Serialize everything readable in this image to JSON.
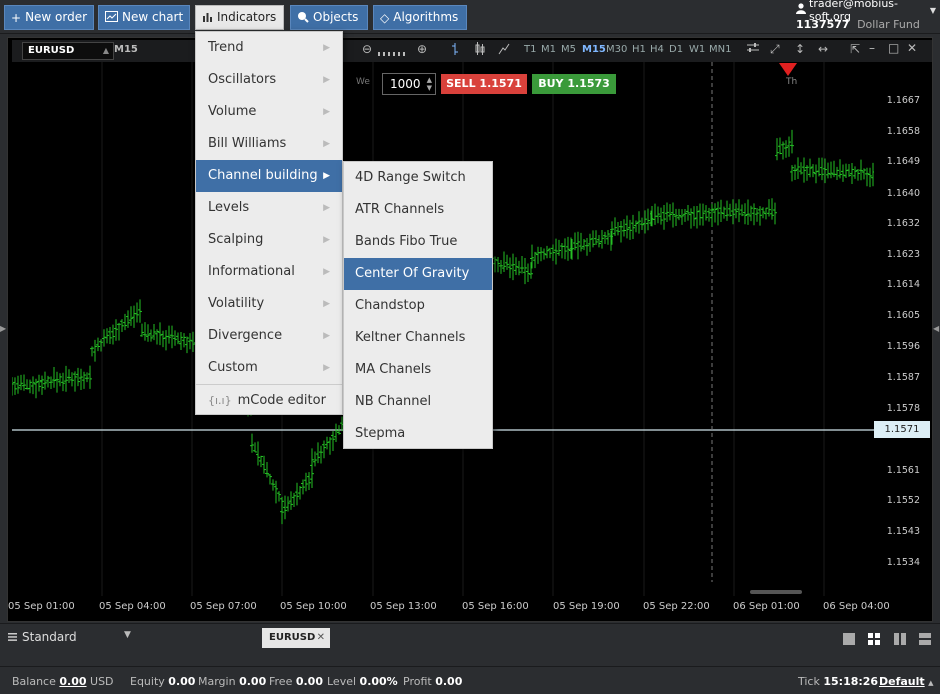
{
  "toolbar": {
    "new_order": "New order",
    "new_chart": "New chart",
    "indicators": "Indicators",
    "objects": "Objects",
    "algorithms": "Algorithms"
  },
  "account": {
    "user": "trader@mobius-soft.org",
    "number": "1137577",
    "fund": "Dollar Fund"
  },
  "chart": {
    "symbol": "EURUSD",
    "timeframe": "M15",
    "timeframes": [
      "T1",
      "M1",
      "M5",
      "M15",
      "M30",
      "H1",
      "H4",
      "D1",
      "W1",
      "MN1"
    ],
    "selected_timeframe": "M15",
    "we_label": "We",
    "th_label": "Th",
    "quantity": "1000",
    "sell_label": "SELL 1.1571",
    "buy_label": "BUY 1.1573",
    "current_price": "1.1571",
    "price_ticks": [
      "1.1667",
      "1.1658",
      "1.1649",
      "1.1640",
      "1.1632",
      "1.1623",
      "1.1614",
      "1.1605",
      "1.1596",
      "1.1587",
      "1.1578",
      "1.1561",
      "1.1552",
      "1.1543",
      "1.1534"
    ],
    "time_ticks": [
      "05 Sep 01:00",
      "05 Sep 04:00",
      "05 Sep 07:00",
      "05 Sep 10:00",
      "05 Sep 13:00",
      "05 Sep 16:00",
      "05 Sep 19:00",
      "05 Sep 22:00",
      "06 Sep 01:00",
      "06 Sep 04:00"
    ],
    "candle_color": "#25c025"
  },
  "indicators_menu": {
    "items": [
      "Trend",
      "Oscillators",
      "Volume",
      "Bill Williams",
      "Channel building",
      "Levels",
      "Scalping",
      "Informational",
      "Volatility",
      "Divergence",
      "Custom"
    ],
    "selected": "Channel building",
    "editor": "mCode editor"
  },
  "channel_submenu": {
    "items": [
      "4D Range Switch",
      "ATR Channels",
      "Bands Fibo True",
      "Center Of Gravity",
      "Chandstop",
      "Keltner Channels",
      "MA Chanels",
      "NB Channel",
      "Stepma"
    ],
    "selected": "Center Of Gravity"
  },
  "tabs": {
    "workspace": "Standard",
    "symbol_tab": "EURUSD"
  },
  "status": {
    "balance_label": "Balance",
    "balance": "0.00",
    "currency": "USD",
    "equity_label": "Equity",
    "equity": "0.00",
    "margin_label": "Margin",
    "margin": "0.00",
    "free_label": "Free",
    "free": "0.00",
    "level_label": "Level",
    "level": "0.00%",
    "profit_label": "Profit",
    "profit": "0.00",
    "tick_label": "Tick",
    "tick_time": "15:18:26",
    "default_label": "Default"
  }
}
